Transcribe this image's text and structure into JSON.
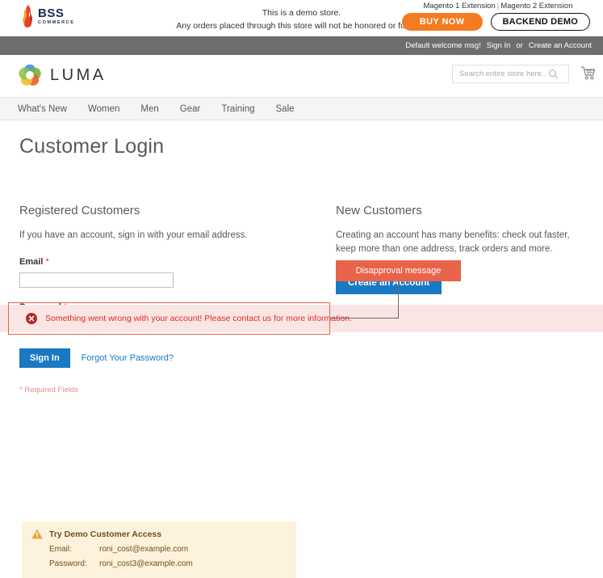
{
  "bss_banner": {
    "logo_name": "BSS",
    "logo_sub": "COMMERCE",
    "demo_line1": "This is a demo store.",
    "demo_line2": "Any orders placed through this store will not be honored or fulfilled.",
    "ext_link_1": "Magento 1 Extension",
    "ext_separator": "|",
    "ext_link_2": "Magento 2 Extension",
    "buy_now_label": "BUY NOW",
    "backend_demo_label": "BACKEND DEMO",
    "buy_now_color": "#f47b20"
  },
  "panel_bar": {
    "welcome": "Default welcome msg!",
    "sign_in": "Sign In",
    "or": "or",
    "create_account": "Create an Account",
    "background": "#6e6e6e"
  },
  "header": {
    "brand": "LUMA",
    "brand_icon": "luma-ring-icon",
    "search_placeholder": "Search entire store here...",
    "search_value": "",
    "search_icon": "search-icon",
    "cart_icon": "cart-icon"
  },
  "nav": {
    "items": [
      {
        "label": "What's New"
      },
      {
        "label": "Women"
      },
      {
        "label": "Men"
      },
      {
        "label": "Gear"
      },
      {
        "label": "Training"
      },
      {
        "label": "Sale"
      }
    ]
  },
  "page": {
    "title": "Customer Login"
  },
  "error_message": {
    "icon": "error-circle-icon",
    "text": "Something went wrong with your account! Please contact us for more information.",
    "text_color": "#e02b27",
    "background": "#fae5e5"
  },
  "annotation": {
    "label": "Disapproval message",
    "box_color": "#e8634a",
    "line_color": "#6b6b6b"
  },
  "registered_customers": {
    "heading": "Registered Customers",
    "description": "If you have an account, sign in with your email address.",
    "email_label": "Email",
    "email_required_mark": "*",
    "email_value": "",
    "password_label": "Password",
    "password_required_mark": "*",
    "password_value": "",
    "sign_in_label": "Sign In",
    "forgot_password_label": "Forgot Your Password?",
    "required_fields_note": "* Required Fields",
    "button_color": "#1979c3"
  },
  "new_customers": {
    "heading": "New Customers",
    "description": "Creating an account has many benefits: check out faster, keep more than one address, track orders and more.",
    "create_account_label": "Create an Account",
    "button_color": "#1979c3"
  },
  "demo_access": {
    "icon": "warning-triangle-icon",
    "title": "Try Demo Customer Access",
    "email_label": "Email:",
    "email_value": "roni_cost@example.com",
    "password_label": "Password:",
    "password_value": "roni_cost3@example.com",
    "background": "#fdf2dc"
  }
}
